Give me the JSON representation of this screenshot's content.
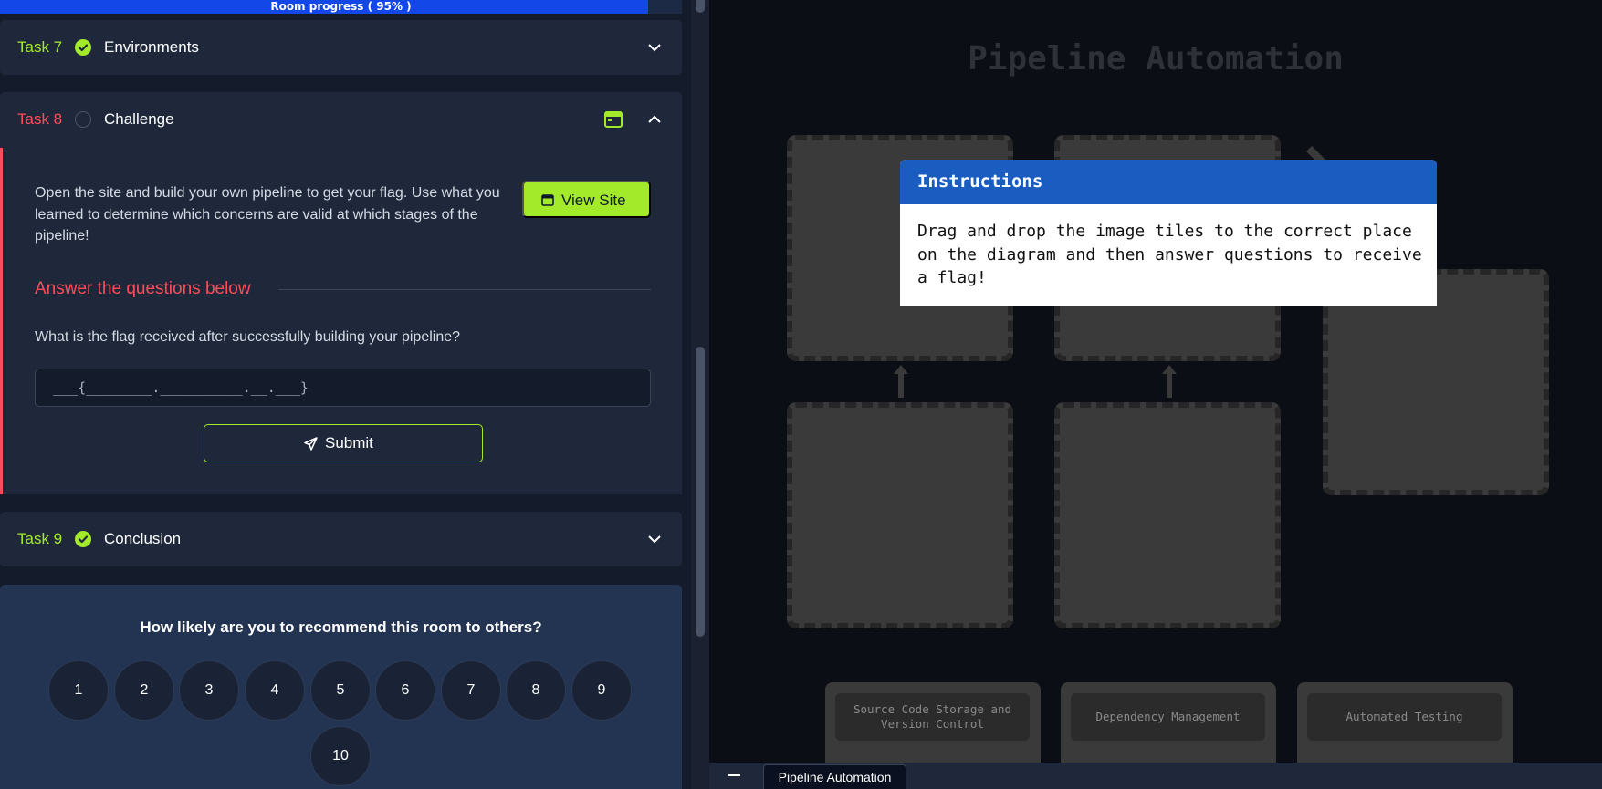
{
  "progress": {
    "label": "Room progress ( 95% )",
    "percent": 95
  },
  "tasks": [
    {
      "number": "Task 7",
      "title": "Environments",
      "status": "done"
    },
    {
      "number": "Task 8",
      "title": "Challenge",
      "status": "todo",
      "description": "Open the site and build your own pipeline to get your flag. Use what you learned to determine which concerns are valid at which stages of the pipeline!",
      "view_site_label": "View Site",
      "answer_heading": "Answer the questions below",
      "question": "What is the flag received after successfully building your pipeline?",
      "answer_placeholder": "___{________.__________.__.___}",
      "submit_label": "Submit"
    },
    {
      "number": "Task 9",
      "title": "Conclusion",
      "status": "done"
    }
  ],
  "rating": {
    "question": "How likely are you to recommend this room to others?",
    "options": [
      "1",
      "2",
      "3",
      "4",
      "5",
      "6",
      "7",
      "8",
      "9",
      "10"
    ]
  },
  "site": {
    "title": "Pipeline Automation",
    "instructions_title": "Instructions",
    "instructions_body": "Drag and drop the image tiles to the correct place on the diagram and then answer questions to receive a flag!",
    "tiles": [
      "Source Code Storage and Version Control",
      "Dependency Management",
      "Automated Testing"
    ]
  },
  "taskbar": {
    "tab_label": "Pipeline Automation"
  },
  "colors": {
    "accent_green": "#a3ea2a",
    "accent_red": "#ff4d58",
    "progress_blue": "#1447e8",
    "modal_blue": "#1a5cbf"
  },
  "icons": [
    "check-circle-icon",
    "empty-circle-icon",
    "chevron-down-icon",
    "chevron-up-icon",
    "browser-window-icon",
    "paper-plane-icon",
    "arrow-up-icon",
    "minimize-icon"
  ]
}
